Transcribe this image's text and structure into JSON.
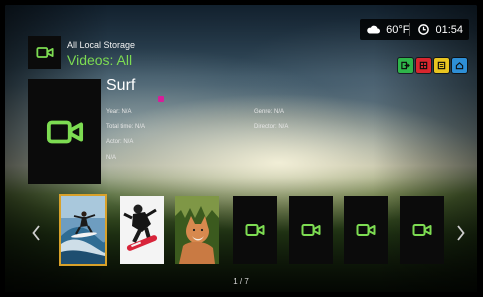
{
  "status_bar": {
    "weather_icon": "cloud-icon",
    "temperature": "60°F",
    "clock_icon": "clock-icon",
    "time": "01:54"
  },
  "color_keys": [
    {
      "name": "green-key",
      "color": "#2fb54a",
      "icon": "exit-icon"
    },
    {
      "name": "red-key",
      "color": "#d8262e",
      "icon": "grid-icon"
    },
    {
      "name": "yellow-key",
      "color": "#e9c520",
      "icon": "menu-icon"
    },
    {
      "name": "blue-key",
      "color": "#2e8fd6",
      "icon": "home-icon"
    }
  ],
  "header": {
    "source_label": "All Local Storage",
    "view_title": "Videos: All"
  },
  "detail": {
    "title": "Surf",
    "year": "Year: N/A",
    "total_time": "Total time: N/A",
    "actor": "Actor: N/A",
    "extra": "N/A",
    "genre": "Genre: N/A",
    "director": "Director: N/A"
  },
  "carousel": {
    "items": [
      {
        "kind": "photo",
        "subject": "surfer",
        "selected": true
      },
      {
        "kind": "photo",
        "subject": "snowboarder",
        "selected": false
      },
      {
        "kind": "photo",
        "subject": "fox",
        "selected": false
      },
      {
        "kind": "video-placeholder",
        "selected": false
      },
      {
        "kind": "video-placeholder",
        "selected": false
      },
      {
        "kind": "video-placeholder",
        "selected": false
      },
      {
        "kind": "video-placeholder",
        "selected": false
      }
    ],
    "page_indicator": "1 / 7"
  },
  "colors": {
    "accent_green": "#7ddc52",
    "selection": "#d8a12a",
    "rating_dot": "#d61e9a"
  }
}
